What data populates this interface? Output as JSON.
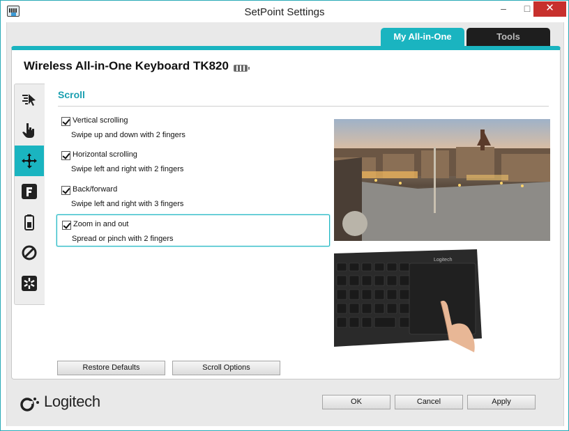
{
  "window": {
    "title": "SetPoint Settings",
    "minimize": "–",
    "maximize": "□",
    "close": "✕"
  },
  "tabs": [
    {
      "label": "My All-in-One",
      "active": true
    },
    {
      "label": "Tools",
      "active": false
    }
  ],
  "device": {
    "name": "Wireless All-in-One Keyboard TK820"
  },
  "sidebar": {
    "items": [
      {
        "icon": "pointer-icon",
        "active": false
      },
      {
        "icon": "hand-icon",
        "active": false
      },
      {
        "icon": "scroll-icon",
        "active": true
      },
      {
        "icon": "f-key-icon",
        "active": false
      },
      {
        "icon": "battery-icon",
        "active": false
      },
      {
        "icon": "block-icon",
        "active": false
      },
      {
        "icon": "settings-icon",
        "active": false
      }
    ]
  },
  "section": {
    "title": "Scroll"
  },
  "options": [
    {
      "label": "Vertical scrolling",
      "description": "Swipe up and down with 2 fingers",
      "checked": true
    },
    {
      "label": "Horizontal scrolling",
      "description": "Swipe left and right with 2 fingers",
      "checked": true
    },
    {
      "label": "Back/forward",
      "description": "Swipe left and right with 3 fingers",
      "checked": true
    },
    {
      "label": "Zoom in and out",
      "description": "Spread or pinch with 2 fingers",
      "checked": true
    }
  ],
  "buttons": {
    "restore_defaults": "Restore Defaults",
    "scroll_options": "Scroll Options",
    "ok": "OK",
    "cancel": "Cancel",
    "apply": "Apply"
  },
  "images": {
    "keyboard_brand": "Logitech"
  },
  "brand": {
    "logo_text": "Logitech"
  },
  "colors": {
    "accent": "#1ab4c0",
    "close": "#c7302d"
  }
}
